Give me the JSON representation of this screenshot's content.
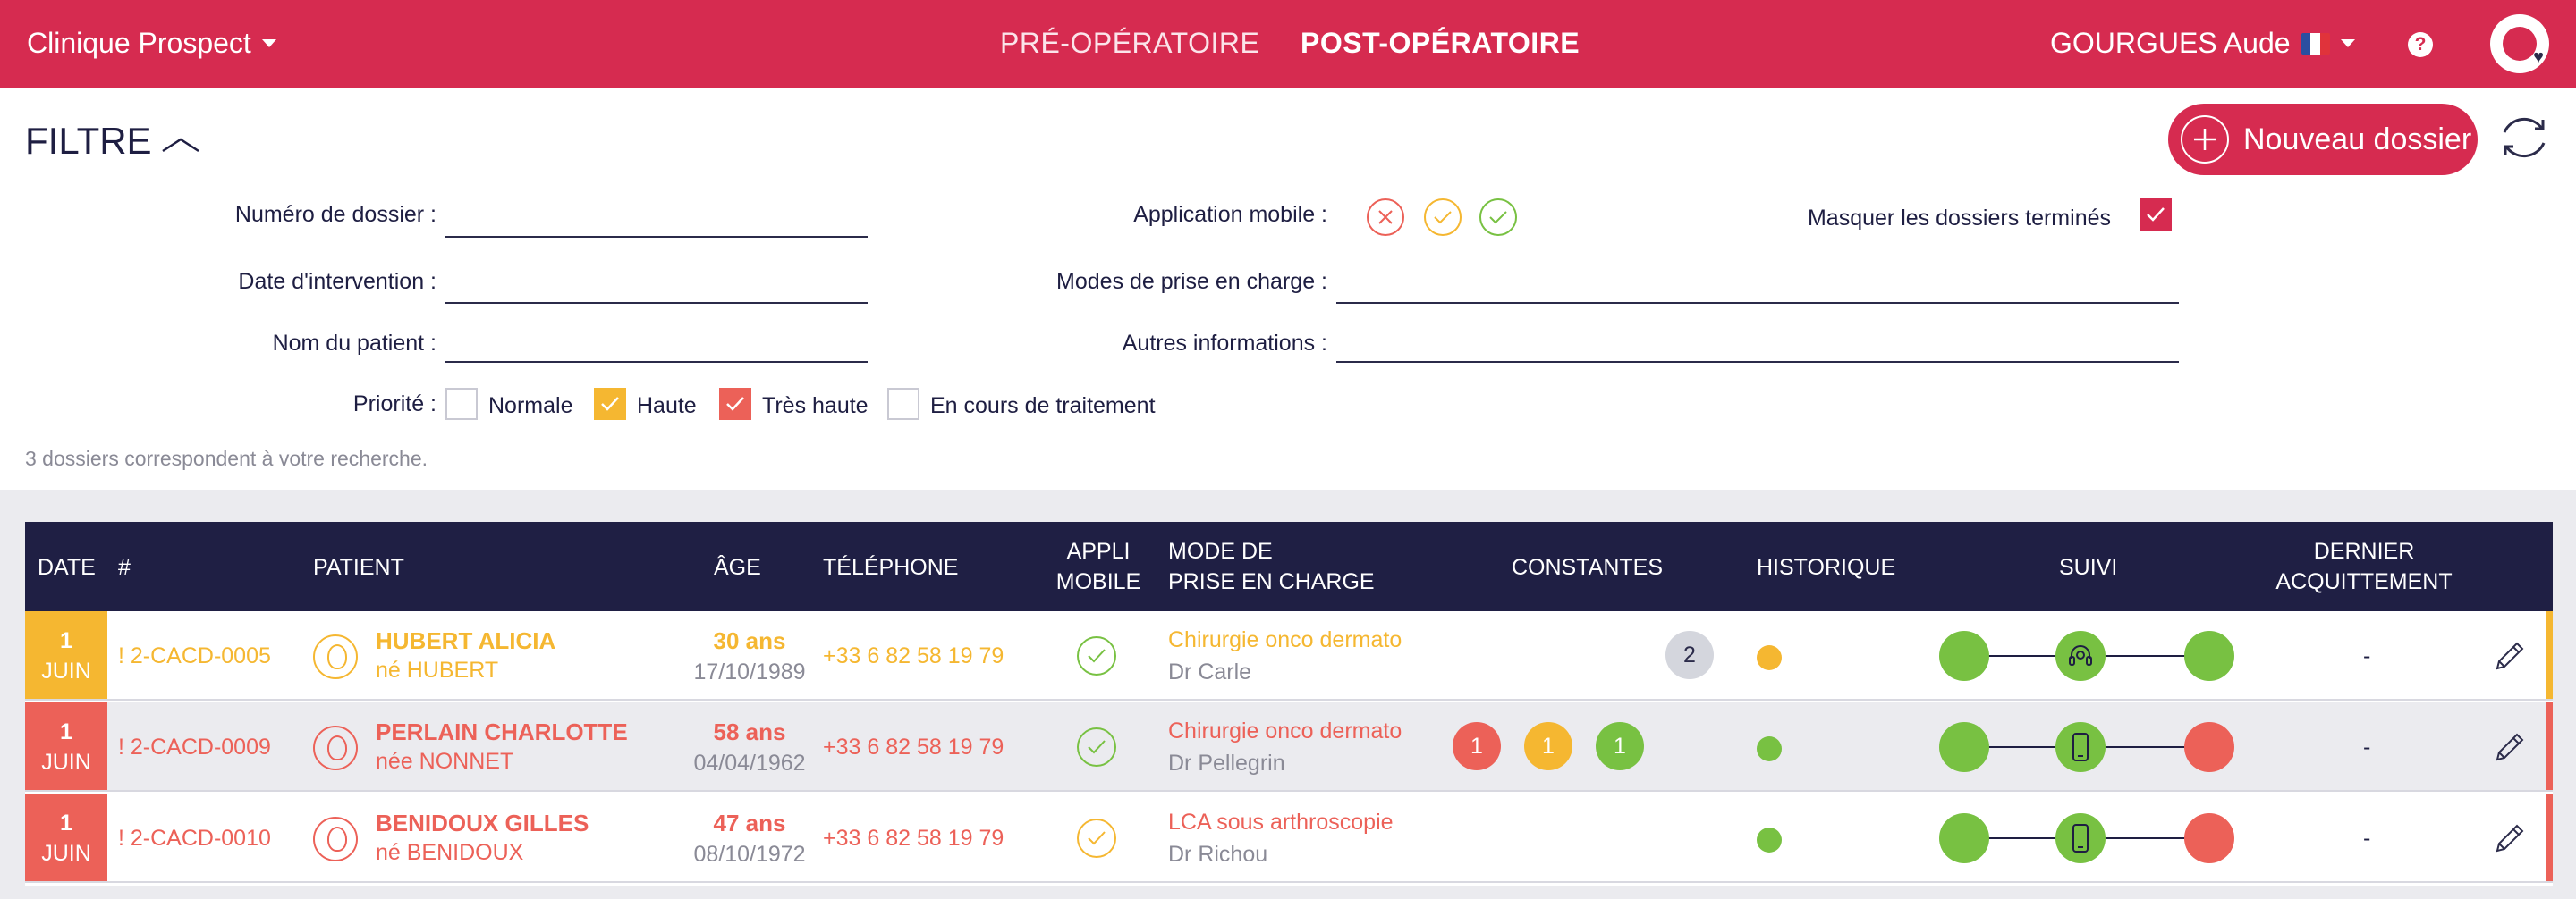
{
  "colors": {
    "brand": "#d62b50",
    "navy": "#1f1f44",
    "orange": "#f5b731",
    "red": "#ec6158",
    "green": "#78c142",
    "gray": "#d4d6dd"
  },
  "topbar": {
    "clinic": "Clinique Prospect",
    "tabs": [
      "PRÉ-OPÉRATOIRE",
      "POST-OPÉRATOIRE"
    ],
    "active_tab": "POST-OPÉRATOIRE",
    "user": "GOURGUES Aude",
    "help_label": "?",
    "icons": [
      "caret-down-icon",
      "france-flag-icon",
      "help-icon",
      "app-logo-icon"
    ]
  },
  "filter": {
    "title": "FILTRE",
    "new_button": "Nouveau dossier",
    "labels": {
      "numero": "Numéro de dossier :",
      "date": "Date d'intervention :",
      "nom": "Nom du patient :",
      "appli": "Application mobile :",
      "modes": "Modes de prise en charge :",
      "autres": "Autres informations :",
      "masquer": "Masquer les dossiers terminés",
      "priorite": "Priorité :"
    },
    "values": {
      "numero": "",
      "date": "",
      "nom": "",
      "modes": "",
      "autres": ""
    },
    "masquer_checked": true,
    "priorities": [
      {
        "label": "Normale",
        "checked": false,
        "color": "#ffffff"
      },
      {
        "label": "Haute",
        "checked": true,
        "color": "#f5b731"
      },
      {
        "label": "Très haute",
        "checked": true,
        "color": "#ec6158"
      },
      {
        "label": "En cours de traitement",
        "checked": false,
        "color": "#ffffff"
      }
    ],
    "result_count": "3 dossiers correspondent à votre recherche."
  },
  "table": {
    "headers": {
      "date": "DATE",
      "num": "#",
      "patient": "PATIENT",
      "age": "ÂGE",
      "tel": "TÉLÉPHONE",
      "appli1": "APPLI",
      "appli2": "MOBILE",
      "mode1": "MODE DE",
      "mode2": "PRISE EN CHARGE",
      "constantes": "CONSTANTES",
      "historique": "HISTORIQUE",
      "suivi": "SUIVI",
      "dernier1": "DERNIER",
      "dernier2": "ACQUITTEMENT"
    },
    "rows": [
      {
        "day": "1",
        "month": "JUIN",
        "num": "! 2-CACD-0005",
        "name": "HUBERT ALICIA",
        "born": "né HUBERT",
        "age": "30 ans",
        "dob": "17/10/1989",
        "phone": "+33 6 82 58 19 79",
        "mode": "Chirurgie onco dermato",
        "doctor": "Dr Carle",
        "constantes": [
          {
            "value": "2",
            "color": "#d4d6dd"
          }
        ],
        "last_ack": "-",
        "suivi_icon": "headset-icon"
      },
      {
        "day": "1",
        "month": "JUIN",
        "num": "! 2-CACD-0009",
        "name": "PERLAIN CHARLOTTE",
        "born": "née NONNET",
        "age": "58 ans",
        "dob": "04/04/1962",
        "phone": "+33 6 82 58 19 79",
        "mode": "Chirurgie onco dermato",
        "doctor": "Dr Pellegrin",
        "constantes": [
          {
            "value": "1",
            "color": "#ec6158"
          },
          {
            "value": "1",
            "color": "#f5b731"
          },
          {
            "value": "1",
            "color": "#78c142"
          }
        ],
        "last_ack": "-",
        "suivi_icon": "smartphone-icon"
      },
      {
        "day": "1",
        "month": "JUIN",
        "num": "! 2-CACD-0010",
        "name": "BENIDOUX GILLES",
        "born": "né BENIDOUX",
        "age": "47 ans",
        "dob": "08/10/1972",
        "phone": "+33 6 82 58 19 79",
        "mode": "LCA sous arthroscopie",
        "doctor": "Dr Richou",
        "constantes": [],
        "last_ack": "-",
        "suivi_icon": "smartphone-icon"
      }
    ]
  }
}
